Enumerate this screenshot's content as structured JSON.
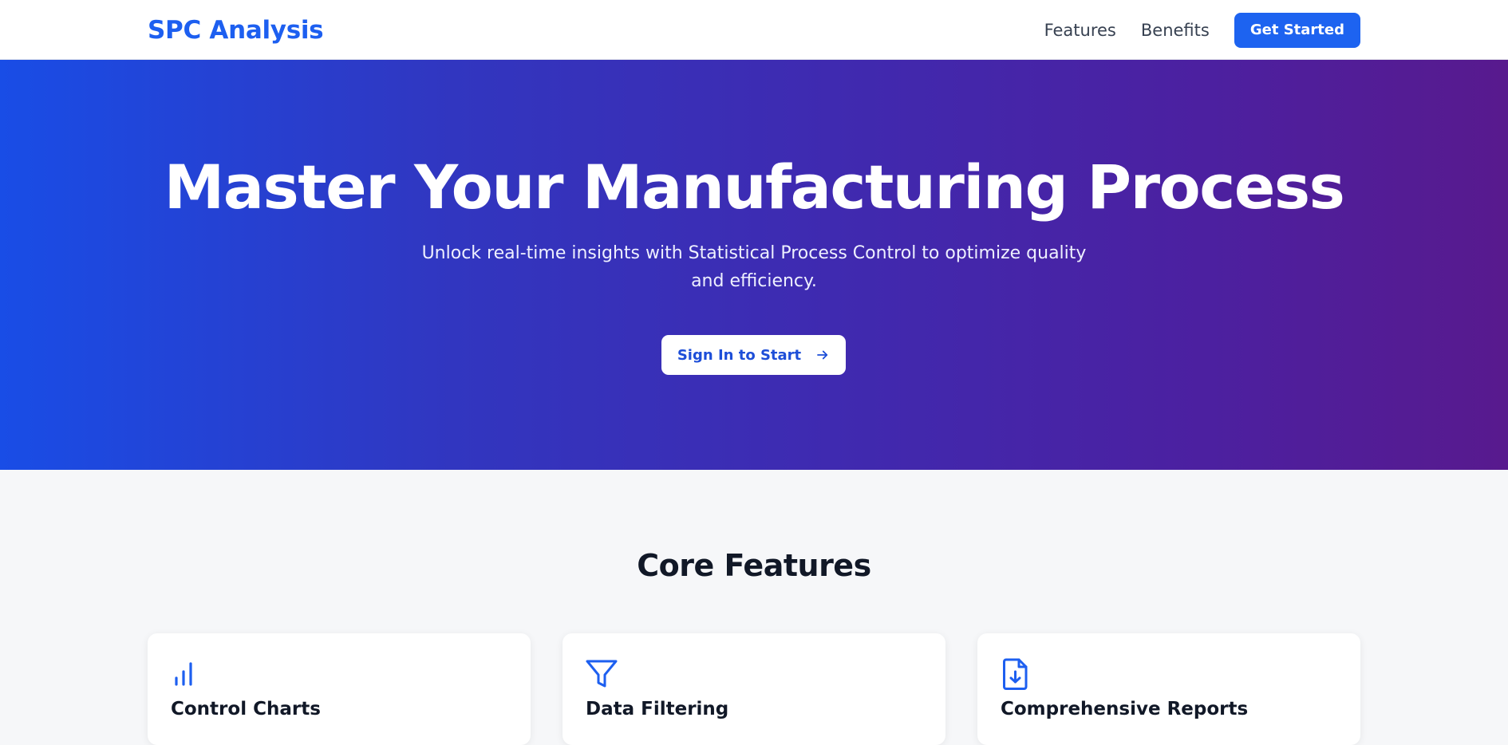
{
  "nav": {
    "brand": "SPC Analysis",
    "links": [
      "Features",
      "Benefits"
    ],
    "cta_label": "Get Started"
  },
  "hero": {
    "title": "Master Your Manufacturing Process",
    "subtitle": "Unlock real-time insights with Statistical Process Control to optimize quality and efficiency.",
    "button_label": "Sign In to Start",
    "button_icon": "arrow-right-icon"
  },
  "features": {
    "heading": "Core Features",
    "cards": [
      {
        "icon": "bar-chart-icon",
        "title": "Control Charts"
      },
      {
        "icon": "filter-icon",
        "title": "Data Filtering"
      },
      {
        "icon": "file-download-icon",
        "title": "Comprehensive Reports"
      }
    ]
  },
  "colors": {
    "brand": "#1d5ff0",
    "primary_button": "#1d63f0",
    "hero_gradient_start": "#194de6",
    "hero_gradient_end": "#581a8e",
    "page_background": "#f6f7f9"
  }
}
